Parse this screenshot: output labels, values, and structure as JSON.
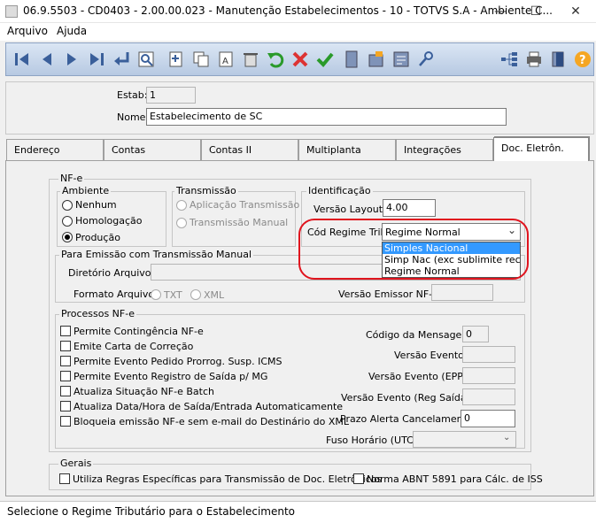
{
  "window": {
    "title": "06.9.5503 - CD0403 - 2.00.00.023 - Manutenção Estabelecimentos - 10 - TOTVS S.A - Ambiente C...",
    "minimize": "—",
    "maximize": "☐",
    "close": "✕"
  },
  "menu": {
    "items": [
      "Arquivo",
      "Ajuda"
    ]
  },
  "header": {
    "estab_label": "Estab:",
    "estab_value": "1",
    "nome_label": "Nome:",
    "nome_value": "Estabelecimento de SC"
  },
  "tabs": [
    {
      "label": "Endereço"
    },
    {
      "label": "Contas"
    },
    {
      "label": "Contas II"
    },
    {
      "label": "Multiplanta"
    },
    {
      "label": "Integrações"
    },
    {
      "label": "Doc. Eletrôn.",
      "active": true
    }
  ],
  "nfe": {
    "title": "NF-e",
    "ambiente": {
      "title": "Ambiente",
      "options": [
        "Nenhum",
        "Homologação",
        "Produção"
      ],
      "selected": "Produção"
    },
    "transmissao": {
      "title": "Transmissão",
      "options": [
        "Aplicação Transmissão",
        "Transmissão Manual"
      ]
    },
    "identificacao": {
      "title": "Identificação",
      "versao_layout_label": "Versão Layout:",
      "versao_layout_value": "4.00",
      "regime_label": "Cód Regime Trib:",
      "regime_value": "Regime Normal",
      "regime_options": [
        "Simples Nacional",
        "Simp Nac (exc sublimite rec brut",
        "Regime Normal"
      ],
      "regime_highlighted": "Simples Nacional"
    },
    "emissao": {
      "title": "Para Emissão com Transmissão Manual",
      "diretorio_label": "Diretório Arquivos:",
      "formato_label": "Formato Arquivo:",
      "formato_options": [
        "TXT",
        "XML"
      ],
      "versao_emissor_label": "Versão Emissor NF-e:"
    },
    "processos": {
      "title": "Processos NF-e",
      "checks": [
        "Permite Contingência NF-e",
        "Emite Carta de Correção",
        "Permite Evento Pedido Prorrog. Susp. ICMS",
        "Permite Evento Registro de Saída p/ MG",
        "Atualiza Situação NF-e Batch",
        "Atualiza Data/Hora de Saída/Entrada Automaticamente",
        "Bloqueia emissão NF-e sem e-mail do Destinário do XML"
      ],
      "codigo_mensagem_label": "Código da Mensagem:",
      "codigo_mensagem_value": "0",
      "versao_evento_label": "Versão Evento:",
      "versao_evento_epp_label": "Versão Evento (EPP):",
      "versao_evento_saida_label": "Versão Evento (Reg Saída):",
      "prazo_label": "Prazo Alerta Cancelamento:",
      "prazo_value": "0",
      "fuso_label": "Fuso Horário (UTC):"
    }
  },
  "gerais": {
    "title": "Gerais",
    "check1": "Utiliza Regras Específicas para Transmissão de Doc. Eletrônicos",
    "check2": "Norma ABNT 5891 para Cálc. de ISS"
  },
  "status": "Selecione o Regime Tributário para o Estabelecimento",
  "colors": {
    "highlight": "#e0141e",
    "selection": "#3399ff",
    "toolbar": "#b7c9e2"
  }
}
